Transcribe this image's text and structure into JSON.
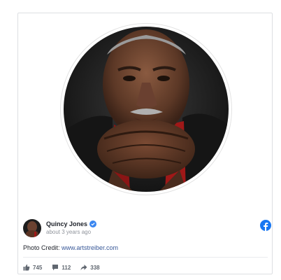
{
  "post": {
    "author_name": "Quincy Jones",
    "timestamp": "about 3 years ago",
    "caption_prefix": "Photo Credit: ",
    "caption_link": "www.artstreiber.com"
  },
  "stats": {
    "likes": "745",
    "comments": "112",
    "shares": "338"
  },
  "icons": {
    "verified": "verified-badge-icon",
    "brand": "facebook-icon",
    "like": "thumbs-up-icon",
    "comment": "comment-bubble-icon",
    "share": "share-arrow-icon"
  },
  "colors": {
    "link": "#385898",
    "facebook_blue": "#1877f2",
    "verified_blue": "#3a86f0",
    "muted_text": "#90949c"
  }
}
